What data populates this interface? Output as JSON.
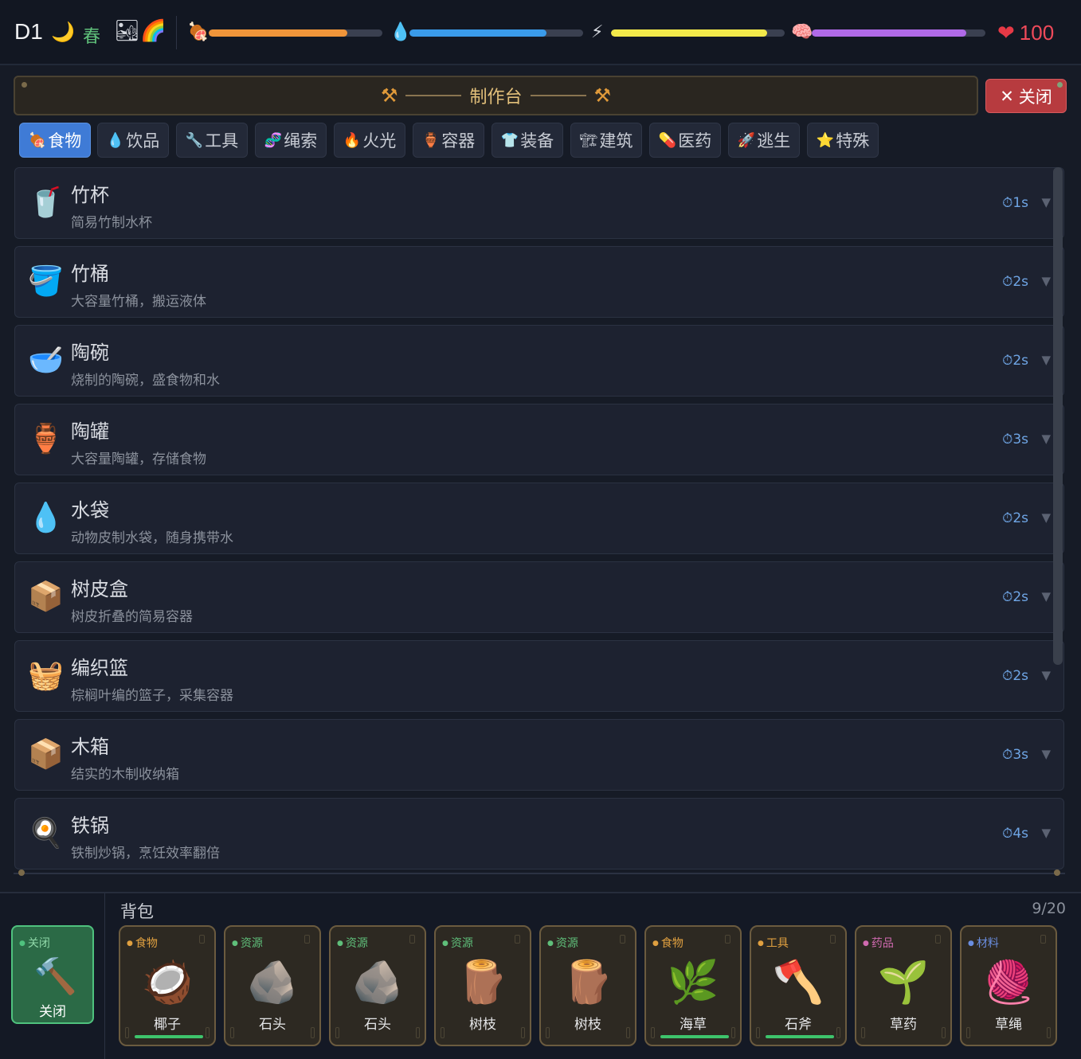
{
  "status": {
    "day": "D1",
    "time_icon": "🌙",
    "season": "春",
    "weather_icon": "🏜🌈",
    "stats": [
      {
        "name": "hunger",
        "icon": "🍖",
        "value": 0.8,
        "color": "#f0953a"
      },
      {
        "name": "thirst",
        "icon": "💧",
        "value": 0.79,
        "color": "#3a9bea"
      },
      {
        "name": "energy",
        "icon": "⚡",
        "value": 0.9,
        "color": "#f2e94a"
      },
      {
        "name": "sanity",
        "icon": "🧠",
        "value": 0.89,
        "color": "#b06ae8"
      }
    ],
    "health": "100",
    "health_icon": "❤"
  },
  "craft": {
    "title": "制作台",
    "close_label": "关闭",
    "close_icon": "✕",
    "hammer_icon": "⚒",
    "tabs": [
      {
        "icon": "🍖",
        "label": "食物",
        "active": true
      },
      {
        "icon": "💧",
        "label": "饮品"
      },
      {
        "icon": "🔧",
        "label": "工具"
      },
      {
        "icon": "🧬",
        "label": "绳索"
      },
      {
        "icon": "🔥",
        "label": "火光"
      },
      {
        "icon": "🏺",
        "label": "容器"
      },
      {
        "icon": "👕",
        "label": "装备"
      },
      {
        "icon": "🏗",
        "label": "建筑"
      },
      {
        "icon": "💊",
        "label": "医药"
      },
      {
        "icon": "🚀",
        "label": "逃生"
      },
      {
        "icon": "⭐",
        "label": "特殊"
      }
    ],
    "recipes": [
      {
        "icon": "🥤",
        "name": "竹杯",
        "desc": "简易竹制水杯",
        "time": "⏱1s"
      },
      {
        "icon": "🪣",
        "name": "竹桶",
        "desc": "大容量竹桶，搬运液体",
        "time": "⏱2s"
      },
      {
        "icon": "🥣",
        "name": "陶碗",
        "desc": "烧制的陶碗，盛食物和水",
        "time": "⏱2s"
      },
      {
        "icon": "🏺",
        "name": "陶罐",
        "desc": "大容量陶罐，存储食物",
        "time": "⏱3s"
      },
      {
        "icon": "💧",
        "name": "水袋",
        "desc": "动物皮制水袋，随身携带水",
        "time": "⏱2s"
      },
      {
        "icon": "📦",
        "name": "树皮盒",
        "desc": "树皮折叠的简易容器",
        "time": "⏱2s"
      },
      {
        "icon": "🧺",
        "name": "编织篮",
        "desc": "棕榈叶编的篮子，采集容器",
        "time": "⏱2s"
      },
      {
        "icon": "📦",
        "name": "木箱",
        "desc": "结实的木制收纳箱",
        "time": "⏱3s"
      },
      {
        "icon": "🍳",
        "name": "铁锅",
        "desc": "铁制炒锅，烹饪效率翻倍",
        "time": "⏱4s"
      }
    ],
    "chevron": "▼"
  },
  "backpack": {
    "title": "背包",
    "count": "9/20",
    "equipped": {
      "tag": "关闭",
      "icon": "🔨",
      "label": "关闭"
    },
    "items": [
      {
        "tag": "食物",
        "tag_color": "#e0a040",
        "icon": "🥥",
        "name": "椰子",
        "durability": 1
      },
      {
        "tag": "资源",
        "tag_color": "#5fbf7a",
        "icon": "🪨",
        "name": "石头"
      },
      {
        "tag": "资源",
        "tag_color": "#5fbf7a",
        "icon": "🪨",
        "name": "石头"
      },
      {
        "tag": "资源",
        "tag_color": "#5fbf7a",
        "icon": "🪵",
        "name": "树枝"
      },
      {
        "tag": "资源",
        "tag_color": "#5fbf7a",
        "icon": "🪵",
        "name": "树枝"
      },
      {
        "tag": "食物",
        "tag_color": "#e0a040",
        "icon": "🌿",
        "name": "海草",
        "durability": 1
      },
      {
        "tag": "工具",
        "tag_color": "#e0a040",
        "icon": "🪓",
        "name": "石斧",
        "durability": 1
      },
      {
        "tag": "药品",
        "tag_color": "#d06ab0",
        "icon": "🌱",
        "name": "草药"
      },
      {
        "tag": "材料",
        "tag_color": "#6a8ee0",
        "icon": "🧶",
        "name": "草绳"
      }
    ]
  }
}
